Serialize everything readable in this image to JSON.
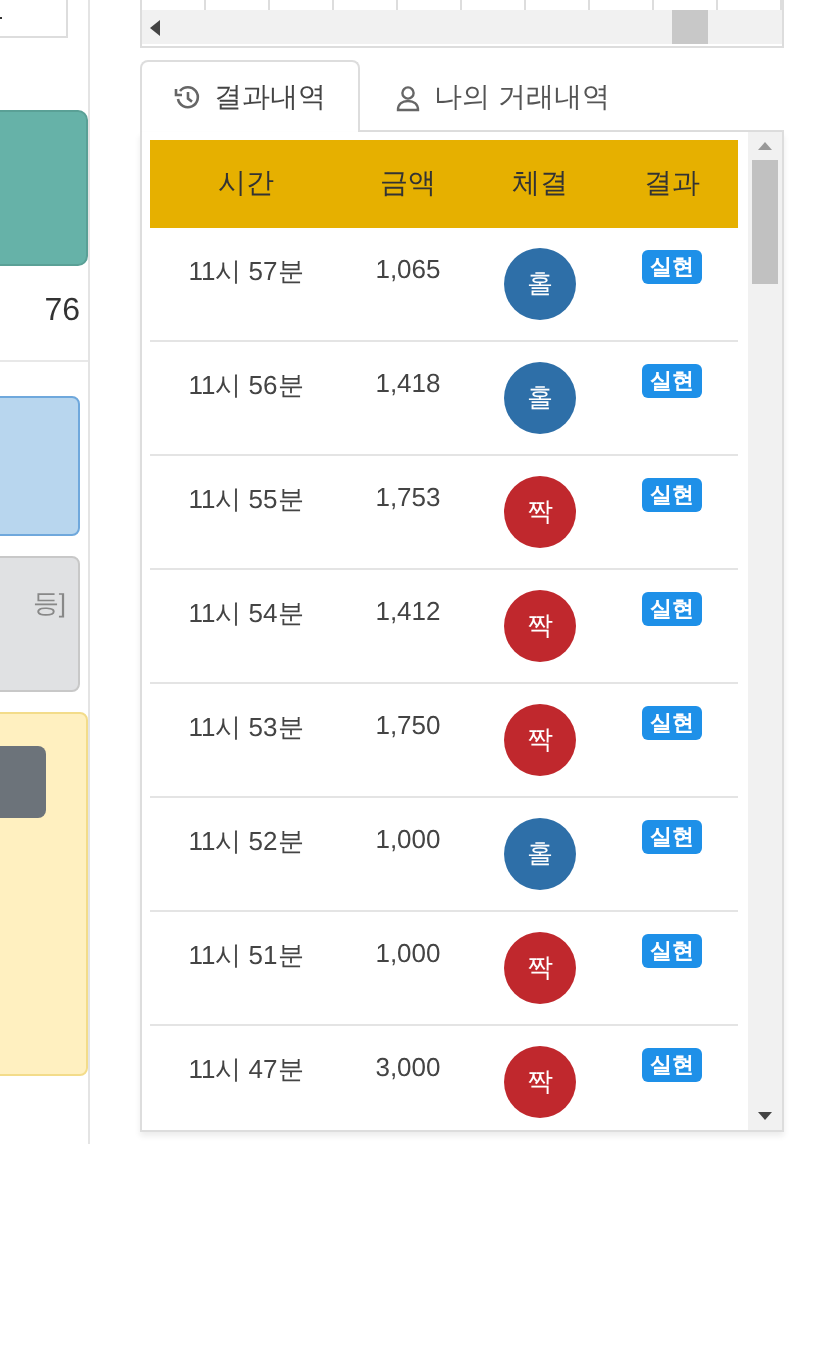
{
  "left_panel": {
    "value": "76",
    "grey_box_text": "등]"
  },
  "tabs": [
    {
      "label": "결과내역",
      "selected": true
    },
    {
      "label": "나의 거래내역",
      "selected": false
    }
  ],
  "table": {
    "columns": [
      "시간",
      "금액",
      "체결",
      "결과"
    ],
    "rows": [
      {
        "time": "11시 57분",
        "amount": "1,065",
        "result": {
          "label": "홀",
          "kind": "odd"
        },
        "status": "실현"
      },
      {
        "time": "11시 56분",
        "amount": "1,418",
        "result": {
          "label": "홀",
          "kind": "odd"
        },
        "status": "실현"
      },
      {
        "time": "11시 55분",
        "amount": "1,753",
        "result": {
          "label": "짝",
          "kind": "even"
        },
        "status": "실현"
      },
      {
        "time": "11시 54분",
        "amount": "1,412",
        "result": {
          "label": "짝",
          "kind": "even"
        },
        "status": "실현"
      },
      {
        "time": "11시 53분",
        "amount": "1,750",
        "result": {
          "label": "짝",
          "kind": "even"
        },
        "status": "실현"
      },
      {
        "time": "11시 52분",
        "amount": "1,000",
        "result": {
          "label": "홀",
          "kind": "odd"
        },
        "status": "실현"
      },
      {
        "time": "11시 51분",
        "amount": "1,000",
        "result": {
          "label": "짝",
          "kind": "even"
        },
        "status": "실현"
      },
      {
        "time": "11시 47분",
        "amount": "3,000",
        "result": {
          "label": "짝",
          "kind": "even"
        },
        "status": "실현"
      }
    ]
  }
}
